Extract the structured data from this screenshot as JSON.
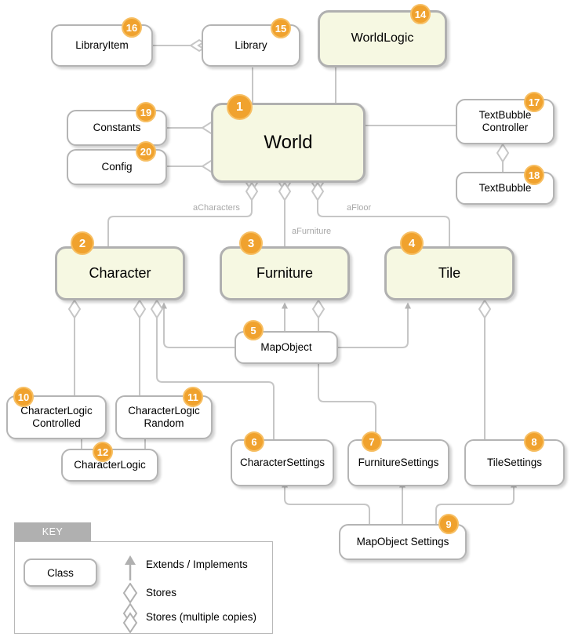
{
  "diagram": {
    "title": "Class diagram",
    "accent_color": "#f0a22e",
    "highlight_fill": "#f6f8e2",
    "line_color": "#b4b4b4"
  },
  "nodes": [
    {
      "id": "world",
      "label": "World",
      "badge": "1",
      "style": "accent-big"
    },
    {
      "id": "character",
      "label": "Character",
      "badge": "2",
      "style": "accent-mid"
    },
    {
      "id": "furniture",
      "label": "Furniture",
      "badge": "3",
      "style": "accent-mid"
    },
    {
      "id": "tile",
      "label": "Tile",
      "badge": "4",
      "style": "accent-mid"
    },
    {
      "id": "mapobject",
      "label": "MapObject",
      "badge": "5",
      "style": "plain"
    },
    {
      "id": "charactersettings",
      "label": "CharacterSettings",
      "badge": "6",
      "style": "plain"
    },
    {
      "id": "furnituresettings",
      "label": "FurnitureSettings",
      "badge": "7",
      "style": "plain"
    },
    {
      "id": "tilesettings",
      "label": "TileSettings",
      "badge": "8",
      "style": "plain"
    },
    {
      "id": "mapobjectsettings",
      "label": "MapObject Settings",
      "badge": "9",
      "style": "plain"
    },
    {
      "id": "characterlogiccontrolled",
      "label": "CharacterLogic\nControlled",
      "badge": "10",
      "style": "plain"
    },
    {
      "id": "characterlogicrandom",
      "label": "CharacterLogic\nRandom",
      "badge": "11",
      "style": "plain"
    },
    {
      "id": "characterlogic",
      "label": "CharacterLogic",
      "badge": "12",
      "style": "plain"
    },
    {
      "id": "worldlogic",
      "label": "WorldLogic",
      "badge": "14",
      "style": "accent-lg"
    },
    {
      "id": "library",
      "label": "Library",
      "badge": "15",
      "style": "plain"
    },
    {
      "id": "libraryitem",
      "label": "LibraryItem",
      "badge": "16",
      "style": "plain"
    },
    {
      "id": "textbubblecontroller",
      "label": "TextBubble\nController",
      "badge": "17",
      "style": "plain"
    },
    {
      "id": "textbubble",
      "label": "TextBubble",
      "badge": "18",
      "style": "plain"
    },
    {
      "id": "constants",
      "label": "Constants",
      "badge": "19",
      "style": "plain"
    },
    {
      "id": "config",
      "label": "Config",
      "badge": "20",
      "style": "plain"
    }
  ],
  "edge_labels": [
    {
      "id": "acharacters",
      "text": "aCharacters"
    },
    {
      "id": "afurniture",
      "text": "aFurniture"
    },
    {
      "id": "afloor",
      "text": "aFloor"
    }
  ],
  "key": {
    "tab_label": "KEY",
    "class_label": "Class",
    "rows": [
      {
        "symbol": "arrow",
        "label": "Extends / Implements"
      },
      {
        "symbol": "diamond",
        "label": "Stores"
      },
      {
        "symbol": "double-diamond",
        "label": "Stores (multiple copies)"
      }
    ]
  }
}
